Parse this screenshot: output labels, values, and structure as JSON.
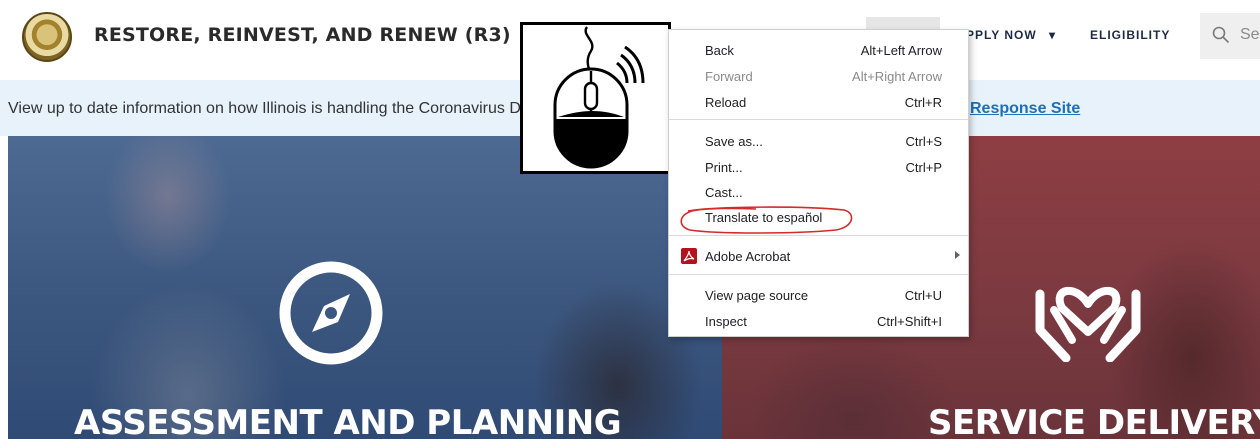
{
  "header": {
    "site_title": "RESTORE, REINVEST, AND RENEW (R3)",
    "nav": {
      "apply_now": "PPLY NOW",
      "eligibility": "ELIGIBILITY"
    },
    "search": {
      "placeholder": "Se",
      "icon": "search-icon"
    }
  },
  "banner": {
    "text": "View up to date information on how Illinois is handling the Coronavirus D",
    "link": "Response Site"
  },
  "hero": {
    "left": {
      "title": "ASSESSMENT AND PLANNING",
      "icon": "compass-icon",
      "tint": "#3d5880"
    },
    "right": {
      "title": "SERVICE DELIVERY",
      "icon": "hands-heart-icon",
      "tint": "#7b3a40"
    }
  },
  "overlay": {
    "icon": "mouse-right-click-icon"
  },
  "context_menu": {
    "items": [
      {
        "label": "Back",
        "shortcut": "Alt+Left Arrow",
        "enabled": true
      },
      {
        "label": "Forward",
        "shortcut": "Alt+Right Arrow",
        "enabled": false
      },
      {
        "label": "Reload",
        "shortcut": "Ctrl+R",
        "enabled": true
      },
      {
        "label": "Save as...",
        "shortcut": "Ctrl+S",
        "enabled": true
      },
      {
        "label": "Print...",
        "shortcut": "Ctrl+P",
        "enabled": true
      },
      {
        "label": "Cast...",
        "shortcut": "",
        "enabled": true
      },
      {
        "label": "Translate to español",
        "shortcut": "",
        "enabled": true,
        "highlighted": true
      },
      {
        "label": "Adobe Acrobat",
        "shortcut": "",
        "enabled": true,
        "submenu": true,
        "icon": "adobe-acrobat-icon"
      },
      {
        "label": "View page source",
        "shortcut": "Ctrl+U",
        "enabled": true
      },
      {
        "label": "Inspect",
        "shortcut": "Ctrl+Shift+I",
        "enabled": true
      }
    ]
  },
  "colors": {
    "accent_link": "#1f6fb5",
    "annotation_red": "#d42a2a",
    "banner_bg": "#e8f2fb"
  }
}
